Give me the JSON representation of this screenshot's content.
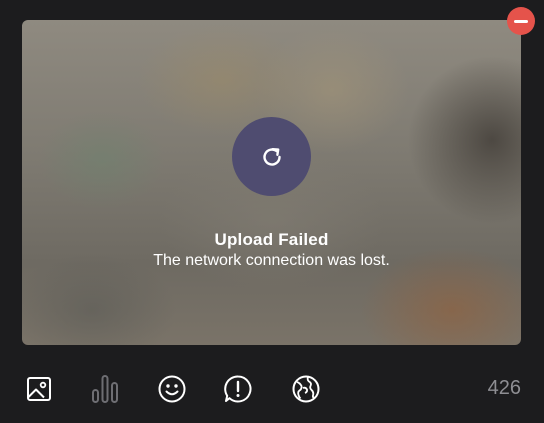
{
  "media": {
    "status_title": "Upload Failed",
    "status_message": "The network connection was lost.",
    "retry_icon": "retry-icon",
    "remove_icon": "remove-icon"
  },
  "toolbar": {
    "icons": [
      "image-icon",
      "poll-icon",
      "emoji-icon",
      "alert-icon",
      "globe-icon"
    ],
    "char_count": "426"
  },
  "colors": {
    "background": "#1c1c1e",
    "retry_button": "#4f4c70",
    "remove_button": "#e5534b",
    "toolbar_icon": "#ffffff",
    "toolbar_icon_disabled": "#6e6e73",
    "char_count": "#8e8e93"
  }
}
